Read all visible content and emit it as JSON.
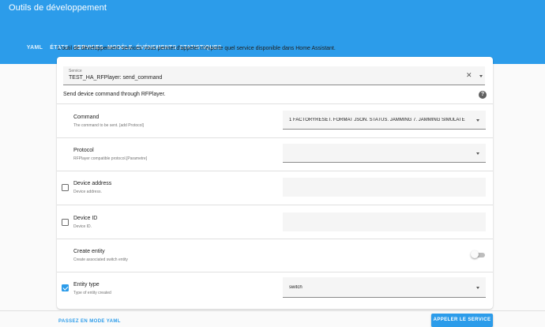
{
  "appbar": {
    "title": "Outils de développement"
  },
  "tabs": [
    {
      "label": "YAML"
    },
    {
      "label": "ÉTATS"
    },
    {
      "label": "SERVICES"
    },
    {
      "label": "MODÈLE"
    },
    {
      "label": "ÉVÉNEMENTS"
    },
    {
      "label": "STATISTIQUES"
    }
  ],
  "active_tab": "SERVICES",
  "intro": "L'outil de développement 'services' vous permet d'appeler n'importe quel service disponible dans Home Assistant.",
  "service": {
    "label": "Service",
    "value": "TEST_HA_RFPlayer: send_command",
    "description": "Send device command through RFPlayer."
  },
  "fields": [
    {
      "title": "Command",
      "subtitle": "The command to be sent. [add Protocol]",
      "value": "1 FACTORYRESET. FORMAT JSON. STATUS. JAMMING 7. JAMMING SIMULATE",
      "checked": false
    },
    {
      "title": "Protocol",
      "subtitle": "RFPlayer compatible protocol.[Parametre]",
      "value": "",
      "checked": false
    },
    {
      "title": "Device address",
      "subtitle": "Device address.",
      "value": "",
      "checked": false
    },
    {
      "title": "Device ID",
      "subtitle": "Device ID.",
      "value": "",
      "checked": false
    },
    {
      "title": "Create entity",
      "subtitle": "Create associated switch entity",
      "value": "",
      "checked": false
    },
    {
      "title": "Entity type",
      "subtitle": "Type of entity created",
      "value": "switch",
      "checked": true
    }
  ],
  "footer": {
    "yaml_label": "PASSEZ EN MODE YAML",
    "call_label": "APPELER LE SERVICE"
  },
  "colors": {
    "primary": "#2c9cea",
    "card": "#ffffff",
    "background": "#fafafa"
  }
}
